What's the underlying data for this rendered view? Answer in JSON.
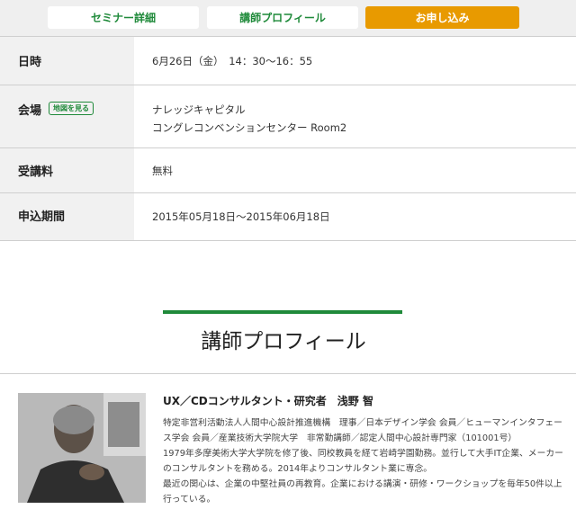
{
  "tabs": [
    {
      "label": "セミナー詳細"
    },
    {
      "label": "講師プロフィール"
    },
    {
      "label": "お申し込み"
    }
  ],
  "info": {
    "date_label": "日時",
    "date_value": "6月26日（金）　14：30〜16：55",
    "venue_label": "会場",
    "map_badge": "地図を見る",
    "venue_line1": "ナレッジキャピタル",
    "venue_line2": "コングレコンベンションセンター Room2",
    "fee_label": "受講料",
    "fee_value": "無料",
    "period_label": "申込期間",
    "period_value": "2015年05月18日〜2015年06月18日"
  },
  "profile_section": {
    "title": "講師プロフィール",
    "name": "UX／CDコンサルタント・研究者　浅野 智",
    "lines": [
      "特定非営利活動法人人間中心設計推進機構　理事／日本デザイン学会 会員／ヒューマンインタフェース学会 会員／産業技術大学院大学　非常勤講師／認定人間中心設計専門家（101001号）",
      "1979年多摩美術大学大学院を修了後、同校教員を経て岩崎学園勤務。並行して大手IT企業、メーカーのコンサルタントを務める。2014年よりコンサルタント業に専念。",
      "最近の関心は、企業の中堅社員の再教育。企業における講演・研修・ワークショップを毎年50件以上行っている。"
    ]
  },
  "colors": {
    "accent_green": "#1f8a3a",
    "accent_orange": "#e89a00"
  }
}
